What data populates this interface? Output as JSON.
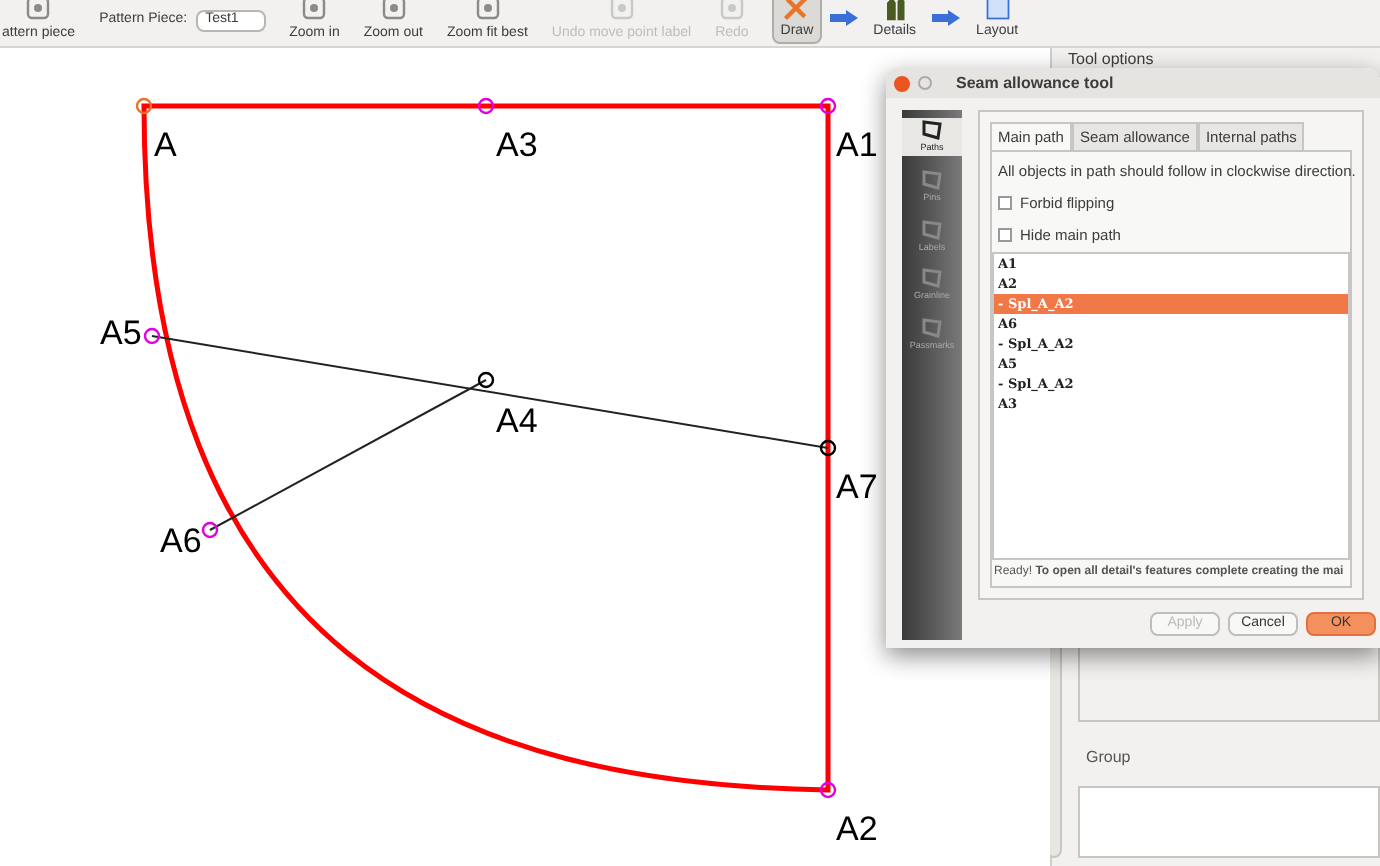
{
  "toolbar": {
    "items": [
      {
        "kind": "tool",
        "label": "attern piece",
        "disabled": false
      },
      {
        "kind": "combo",
        "label": "Pattern Piece:",
        "value": "Test1"
      },
      {
        "kind": "tool",
        "label": "Zoom in",
        "disabled": false
      },
      {
        "kind": "tool",
        "label": "Zoom out",
        "disabled": false
      },
      {
        "kind": "tool",
        "label": "Zoom fit best",
        "disabled": false
      },
      {
        "kind": "tool",
        "label": "Undo move point label",
        "disabled": true
      },
      {
        "kind": "tool",
        "label": "Redo",
        "disabled": true
      }
    ],
    "modes": [
      {
        "label": "Draw",
        "selected": true
      },
      {
        "label": "Details",
        "selected": false
      },
      {
        "label": "Layout",
        "selected": false
      }
    ]
  },
  "canvas": {
    "points": [
      {
        "label": "A",
        "color": "#e8742a"
      },
      {
        "label": "A3",
        "color": "#e000e0"
      },
      {
        "label": "A1",
        "color": "#e000e0"
      },
      {
        "label": "A5",
        "color": "#e000e0"
      },
      {
        "label": "A4",
        "color": "#000000"
      },
      {
        "label": "A7",
        "color": "#000000"
      },
      {
        "label": "A6",
        "color": "#e000e0"
      },
      {
        "label": "A2",
        "color": "#e000e0"
      }
    ]
  },
  "dock": {
    "title": "Tool options",
    "group_title": "Group"
  },
  "dialog": {
    "title": "Seam allowance tool",
    "sidebar": [
      {
        "label": "Paths",
        "selected": true
      },
      {
        "label": "Pins",
        "selected": false
      },
      {
        "label": "Labels",
        "selected": false
      },
      {
        "label": "Grainline",
        "selected": false
      },
      {
        "label": "Passmarks",
        "selected": false
      }
    ],
    "tabs": [
      {
        "label": "Main path",
        "selected": true
      },
      {
        "label": "Seam allowance",
        "selected": false
      },
      {
        "label": "Internal paths",
        "selected": false
      }
    ],
    "hint": "All objects in path should follow in clockwise direction.",
    "checkboxes": [
      {
        "label": "Forbid flipping",
        "checked": false
      },
      {
        "label": "Hide main path",
        "checked": false
      }
    ],
    "path_items": [
      {
        "label": "A1",
        "selected": false
      },
      {
        "label": "A2",
        "selected": false
      },
      {
        "label": "- Spl_A_A2",
        "selected": true
      },
      {
        "label": "A6",
        "selected": false
      },
      {
        "label": "- Spl_A_A2",
        "selected": false
      },
      {
        "label": "A5",
        "selected": false
      },
      {
        "label": "- Spl_A_A2",
        "selected": false
      },
      {
        "label": "A3",
        "selected": false
      }
    ],
    "status": "Ready! **To open all detail's features complete creating the mai**",
    "buttons": [
      {
        "label": "Apply",
        "kind": "normal",
        "disabled": true
      },
      {
        "label": "Cancel",
        "kind": "normal",
        "disabled": false
      },
      {
        "label": "OK",
        "kind": "default",
        "disabled": false
      }
    ]
  }
}
